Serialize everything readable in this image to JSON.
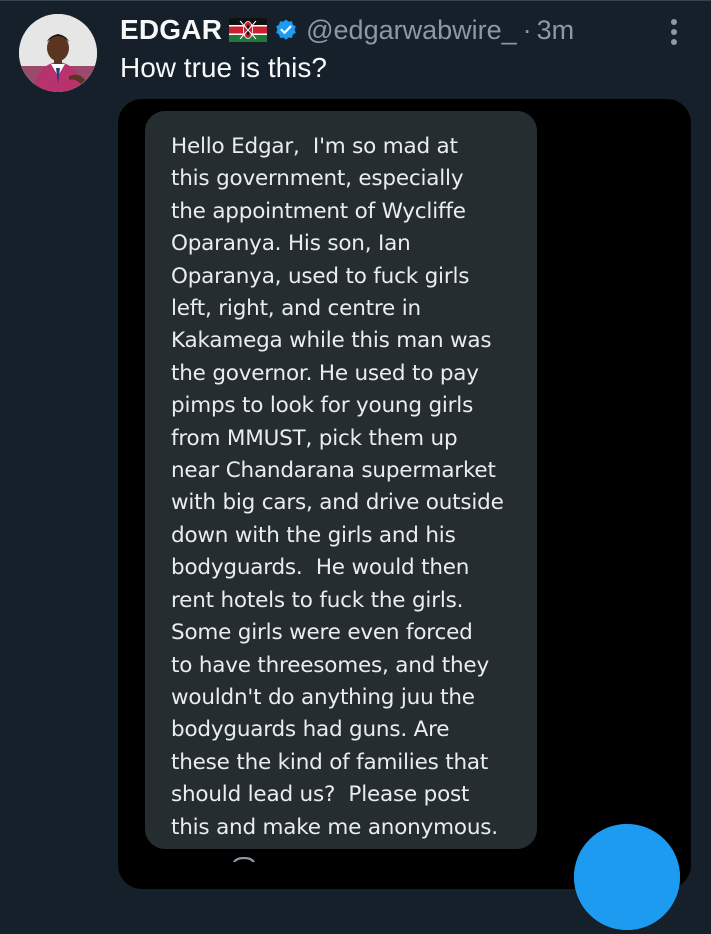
{
  "tweet": {
    "display_name": "EDGAR",
    "flag_icon": "kenya-flag-icon",
    "verified_icon": "verified-badge-icon",
    "handle": "@edgarwabwire_",
    "separator": "·",
    "time": "3m",
    "more_icon": "more-vertical-icon",
    "text": "How true is this?"
  },
  "message": {
    "lines": [
      "Hello Edgar,  I'm so mad at",
      "this government, especially",
      "the appointment of Wycliffe",
      "Oparanya. His son, Ian",
      "Oparanya, used to fuck girls",
      "left, right, and centre in",
      "Kakamega while this man was",
      "the governor. He used to pay",
      "pimps to look for young girls",
      "from MMUST, pick them up",
      "near Chandarana supermarket",
      "with big cars, and drive outside",
      "down with the girls and his",
      "bodyguards.  He would then",
      "rent hotels to fuck the girls.",
      "Some girls were even forced",
      "to have threesomes, and they",
      "wouldn't do anything juu the",
      "bodyguards had guns. Are",
      "these the kind of families that",
      "should lead us?  Please post",
      "this and make me anonymous."
    ]
  },
  "colors": {
    "background": "#15202b",
    "media_background": "#000000",
    "bubble": "#262d31",
    "accent": "#1d9bf0",
    "secondary_text": "#8b98a5"
  }
}
